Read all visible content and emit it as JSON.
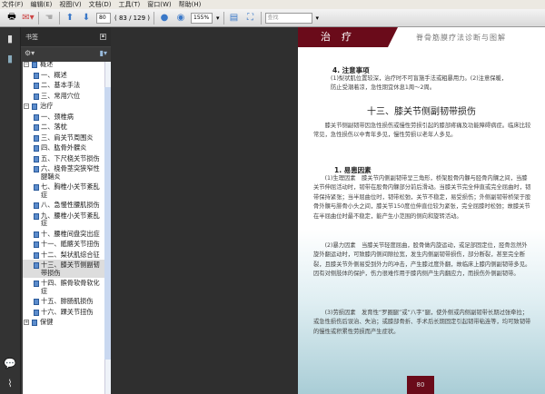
{
  "menu": [
    "文件(F)",
    "编辑(E)",
    "视图(V)",
    "文档(D)",
    "工具(T)",
    "窗口(W)",
    "帮助(H)"
  ],
  "toolbar": {
    "page_input": "80",
    "page_count": "( 83 / 129 )",
    "zoom": "155%",
    "search_placeholder": "查找"
  },
  "panel": {
    "title": "书签"
  },
  "bookmarks": [
    {
      "label": "概述",
      "level": 0,
      "expander": "−"
    },
    {
      "label": "一、概述",
      "level": 1
    },
    {
      "label": "二、基本手法",
      "level": 1
    },
    {
      "label": "三、常用穴位",
      "level": 1
    },
    {
      "label": "治疗",
      "level": 0,
      "expander": "−"
    },
    {
      "label": "一、颈椎病",
      "level": 1
    },
    {
      "label": "二、落枕",
      "level": 1
    },
    {
      "label": "三、肩关节周围炎",
      "level": 1
    },
    {
      "label": "四、肱骨外髁炎",
      "level": 1
    },
    {
      "label": "五、下尺桡关节损伤",
      "level": 1
    },
    {
      "label": "六、桡骨茎突狭窄性腱鞘炎",
      "level": 1
    },
    {
      "label": "七、胸椎小关节紊乱症",
      "level": 1
    },
    {
      "label": "八、急慢性腰肌损伤",
      "level": 1
    },
    {
      "label": "九、腰椎小关节紊乱症",
      "level": 1
    },
    {
      "label": "十、腰椎间盘突出症",
      "level": 1
    },
    {
      "label": "十一、骶髂关节扭伤",
      "level": 1
    },
    {
      "label": "十二、梨状肌综合征",
      "level": 1
    },
    {
      "label": "十三、膝关节侧副韧带损伤",
      "level": 1,
      "selected": true
    },
    {
      "label": "十四、髌骨软骨软化症",
      "level": 1
    },
    {
      "label": "十五、腓肠肌损伤",
      "level": 1
    },
    {
      "label": "十六、踝关节扭伤",
      "level": 1
    },
    {
      "label": "保健",
      "level": 0,
      "expander": "+"
    }
  ],
  "document": {
    "band": "治疗",
    "header_title": "脊骨筋膜疗法诊断与图解",
    "s4_heading": "4. 注意事项",
    "s4_text": "(1)梨状肌位置较深，治疗时不可盲施手法或粗暴用力。(2)注意保暖，防止受潮着凉，急性期宜休息1周～2周。",
    "section_title": "十三、膝关节侧副韧带损伤",
    "intro": "膝关节侧副韧带因急性损伤或慢性劳损引起的膝部疼痛及功能障碍病症。临床比较常见，急性损伤以中青年多见，慢性劳损以老年人多见。",
    "s1_heading": "1. 易患因素",
    "p1": "(1)生理因素　膝关节内侧副韧带呈三角形，桥架股骨内髁与胫骨内髁之间，当膝关节伸屈活动时，韧带在股骨内髁部分前后滑动。当膝关节完全伸直或完全屈曲时，韧带保持紧张；当半屈曲位时，韧带松弛，关节不稳定，易受损伤；外侧副韧带桥架于股骨外髁与腓骨小头之间，膝关节150度位伸直位较为紧张，完全屈膝时松弛；故膝关节在半屈曲位时最不稳定，能产生小范围的侧向和旋转活动。",
    "p2": "(2)暴力因素　当膝关节轻度屈曲，股骨做内旋运动，或足部固定位，胫骨忽然外旋外翻运动时，可致膝内侧间隙拉宽，发生内侧副韧带损伤，部分断裂，甚至完全断裂，且膝关节外侧易受到外力的冲击，产生膝过度外翻，故临床上膝内侧副韧带多见。因有对侧肢体的保护，伤力很难作用于膝内侧产生内翻应力，而损伤外侧副韧带。",
    "p3": "(3)劳损因素　发育性“罗圈腿”或“八字”腿，使外侧或内侧副韧带长期过张牵拉；或急性损伤后误治、失治；或膝部骨折、手术后长期固定引起韧带粘连等，均可致韧带的慢性或积累性劳损而产生症状。",
    "page_number": "80"
  }
}
